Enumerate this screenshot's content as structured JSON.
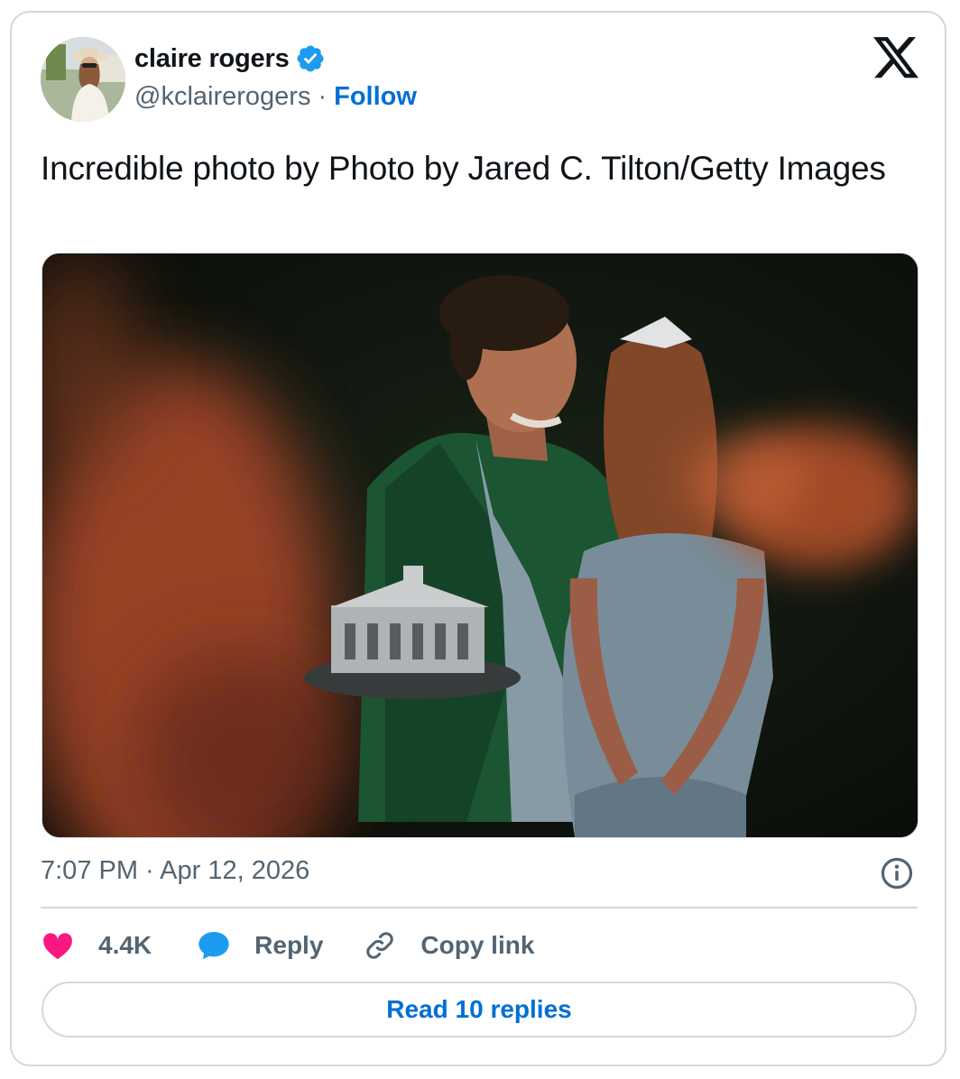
{
  "author": {
    "name": "claire rogers",
    "handle": "@kclairerogers",
    "separator": "·",
    "follow_label": "Follow",
    "verified_icon": "verified-badge-icon",
    "verified_color": "#1d9bf0"
  },
  "tweet": {
    "text": "Incredible photo by Photo by Jared C. Tilton/Getty Images",
    "timestamp": "7:07 PM · Apr 12, 2026"
  },
  "actions": {
    "likes": "4.4K",
    "like_icon": "heart-icon",
    "like_color": "#f91880",
    "reply_label": "Reply",
    "reply_icon": "speech-bubble-icon",
    "reply_color": "#1d9bf0",
    "copy_label": "Copy link",
    "copy_icon": "link-icon"
  },
  "read_replies_label": "Read 10 replies",
  "colors": {
    "accent": "#006fd6",
    "secondary_text": "#536471",
    "border": "#cfd9de"
  }
}
